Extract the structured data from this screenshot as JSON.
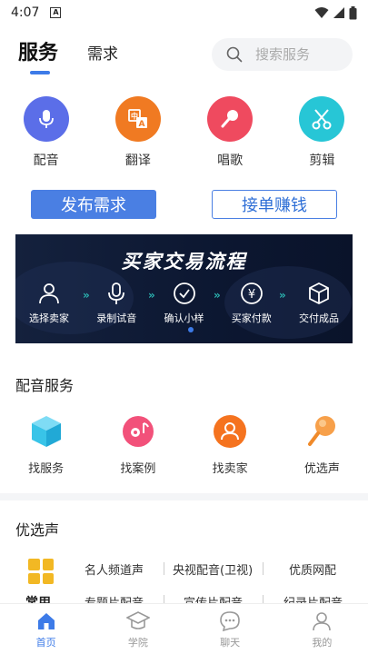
{
  "status_bar": {
    "time": "4:07",
    "a_label": "A"
  },
  "header": {
    "tabs": [
      {
        "label": "服务",
        "active": true
      },
      {
        "label": "需求",
        "active": false
      }
    ],
    "search": {
      "placeholder": "搜索服务"
    }
  },
  "categories": [
    {
      "label": "配音",
      "icon": "microphone-icon",
      "color": "#5b6ee8"
    },
    {
      "label": "翻译",
      "icon": "translate-icon",
      "color": "#f07a22"
    },
    {
      "label": "唱歌",
      "icon": "karaoke-mic-icon",
      "color": "#ef4a5f"
    },
    {
      "label": "剪辑",
      "icon": "scissors-icon",
      "color": "#27c6d6"
    }
  ],
  "actions": {
    "publish_label": "发布需求",
    "take_label": "接单赚钱"
  },
  "banner": {
    "title": "买家交易流程",
    "steps": [
      {
        "label": "选择卖家",
        "icon": "person-icon"
      },
      {
        "label": "录制试音",
        "icon": "microphone-icon"
      },
      {
        "label": "确认小样",
        "icon": "check-circle-icon"
      },
      {
        "label": "买家付款",
        "icon": "yen-icon"
      },
      {
        "label": "交付成品",
        "icon": "box-icon"
      }
    ]
  },
  "dubbing_section": {
    "title": "配音服务",
    "items": [
      {
        "label": "找服务",
        "icon": "cube-icon",
        "color": "#38c4e8"
      },
      {
        "label": "找案例",
        "icon": "music-disc-icon",
        "color": "#f2517a"
      },
      {
        "label": "找卖家",
        "icon": "seller-icon",
        "color": "#f5731f"
      },
      {
        "label": "优选声",
        "icon": "popsicle-mic-icon",
        "color": "#f7a04a"
      }
    ]
  },
  "featured_section": {
    "title": "优选声",
    "common_label": "常用",
    "row1": [
      "名人频道声",
      "央视配音(卫视)",
      "优质网配"
    ],
    "row2": [
      "专题片配音",
      "宣传片配音",
      "纪录片配音"
    ]
  },
  "bottom_nav": [
    {
      "label": "首页",
      "icon": "home-icon",
      "active": true
    },
    {
      "label": "学院",
      "icon": "graduation-cap-icon",
      "active": false
    },
    {
      "label": "聊天",
      "icon": "chat-icon",
      "active": false
    },
    {
      "label": "我的",
      "icon": "profile-icon",
      "active": false
    }
  ],
  "colors": {
    "accent": "#3d7be8",
    "banner_bg": "#0c1731"
  }
}
